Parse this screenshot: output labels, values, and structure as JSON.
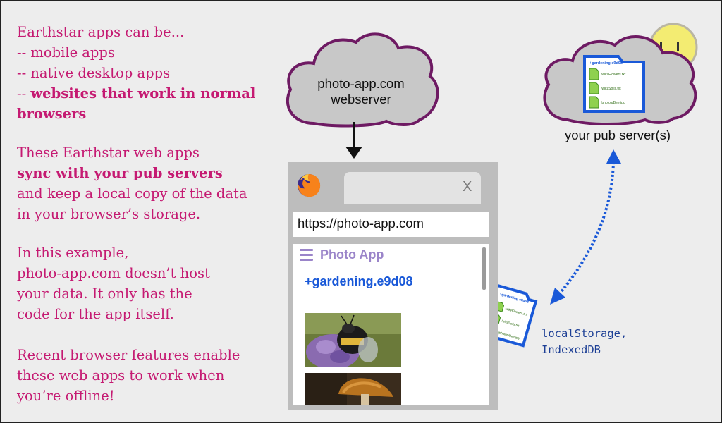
{
  "text": {
    "intro": {
      "l1": "Earthstar apps can be...",
      "l2": "-- mobile apps",
      "l3": "-- native desktop apps",
      "l4a": "-- ",
      "l4b": "websites that work in normal",
      "l5": "browsers"
    },
    "sync": {
      "l1": "These Earthstar web apps",
      "l2": "sync with your pub servers",
      "l3": "and keep a local copy of the data",
      "l4": "in your browser’s storage."
    },
    "example": {
      "l1": "In this example,",
      "l2": "photo-app.com doesn’t host",
      "l3": "your data.  It only has the",
      "l4": "code for the app itself."
    },
    "offline": {
      "l1": "Recent browser features enable",
      "l2": "these web apps to work when",
      "l3": "you’re offline!"
    }
  },
  "webserver": {
    "line1": "photo-app.com",
    "line2": "webserver"
  },
  "pub": {
    "label": "your pub server(s)",
    "workspace": "+gardening.e9d08",
    "files": [
      "/wiki/Flowers.txt",
      "/wiki/Soils.txt",
      "/photos/Bee.jpg"
    ]
  },
  "browser": {
    "tab_close": "X",
    "url": "https://photo-app.com",
    "app_title": "Photo App",
    "workspace": "+gardening.e9d08"
  },
  "local": {
    "line1": "localStorage,",
    "line2": "IndexedDB",
    "workspace": "+gardening.e9d08",
    "files": [
      "/wiki/Flowers.txt",
      "/wiki/Soils.txt",
      "/photos/Bee.jpg"
    ]
  },
  "colors": {
    "magenta": "#c51a72",
    "cloud_fill": "#c8c8c8",
    "cloud_stroke": "#6e1a63",
    "blue": "#1a59d8",
    "purple": "#9a84c9",
    "sun": "#f3ec72"
  },
  "icons": [
    "firefox-icon",
    "hamburger-menu-icon",
    "document-icon",
    "folder-icon",
    "sun-icon"
  ]
}
